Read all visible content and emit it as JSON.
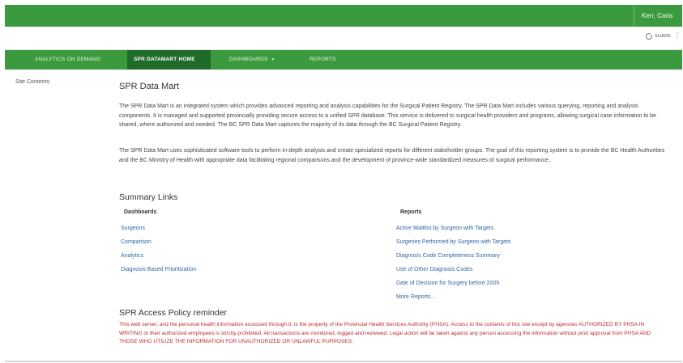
{
  "suite_bar": {
    "user_name": "Kerr, Carla"
  },
  "ribbon": {
    "share_label": "SHARE"
  },
  "top_nav": {
    "items": [
      {
        "label": "ANALYTICS ON DEMAND"
      },
      {
        "label": "SPR DATAMART HOME"
      },
      {
        "label": "DASHBOARDS"
      },
      {
        "label": "REPORTS"
      }
    ]
  },
  "left_nav": {
    "site_contents": "Site Contents"
  },
  "page": {
    "title": "SPR Data Mart",
    "paragraph1": "The SPR Data Mart is an integrated system which provides advanced reporting and analysis capabilities for the Surgical Patient Registry.  The SPR Data Mart includes various querying, reporting and analysis components. It is managed and supported provincially providing secure access to a unified SPR database.  This service is delivered to surgical health providers and programs, allowing surgical case information to be shared, where authorized and needed.  The BC SPR Data Mart captures the majority of its data through the BC Surgical Patient Registry.",
    "paragraph2": "The SPR Data Mart uses sophisticated software tools to perform in-depth analysis and create specialized reports for different stakeholder groups.  The goal of this reporting system is to provide the BC Health Authorities and the BC Ministry of Health with appropriate data facilitating regional comparisons and the development of province-wide standardized measures of surgical performance."
  },
  "summary": {
    "heading": "Summary Links",
    "dashboards_heading": "Dashboards",
    "reports_heading": "Reports",
    "dashboards": [
      {
        "label": "Surgeons"
      },
      {
        "label": "Comparison"
      },
      {
        "label": "Analytics"
      },
      {
        "label": "Diagnosis Based Prioritization"
      }
    ],
    "reports": [
      {
        "label": "Active Waitlist by Surgeon with Targets"
      },
      {
        "label": "Surgeries Performed by Surgeon with Targets"
      },
      {
        "label": "Diagnosis Code Completeness Summary"
      },
      {
        "label": "Use of Other Diagnosis Codes"
      },
      {
        "label": "Date of Decision for Surgery before 2005"
      },
      {
        "label": "More Reports..."
      }
    ]
  },
  "policy": {
    "heading": "SPR Access Policy reminder",
    "text": "This web server, and the personal health information accessed through it, is the property of the Provincial Health Services Authority (PHSA). Access to the contents of this site except by agencies AUTHORIZED BY PHSA IN WRITING or their authorized employees is strictly prohibited. All transactions are monitored, logged and reviewed. Legal action will be taken against any person accessing the information without prior approval from PHSA AND THOSE WHO UTILIZE THE INFORMATION FOR UNAUTHORIZED OR UNLAWFUL PURPOSES."
  }
}
